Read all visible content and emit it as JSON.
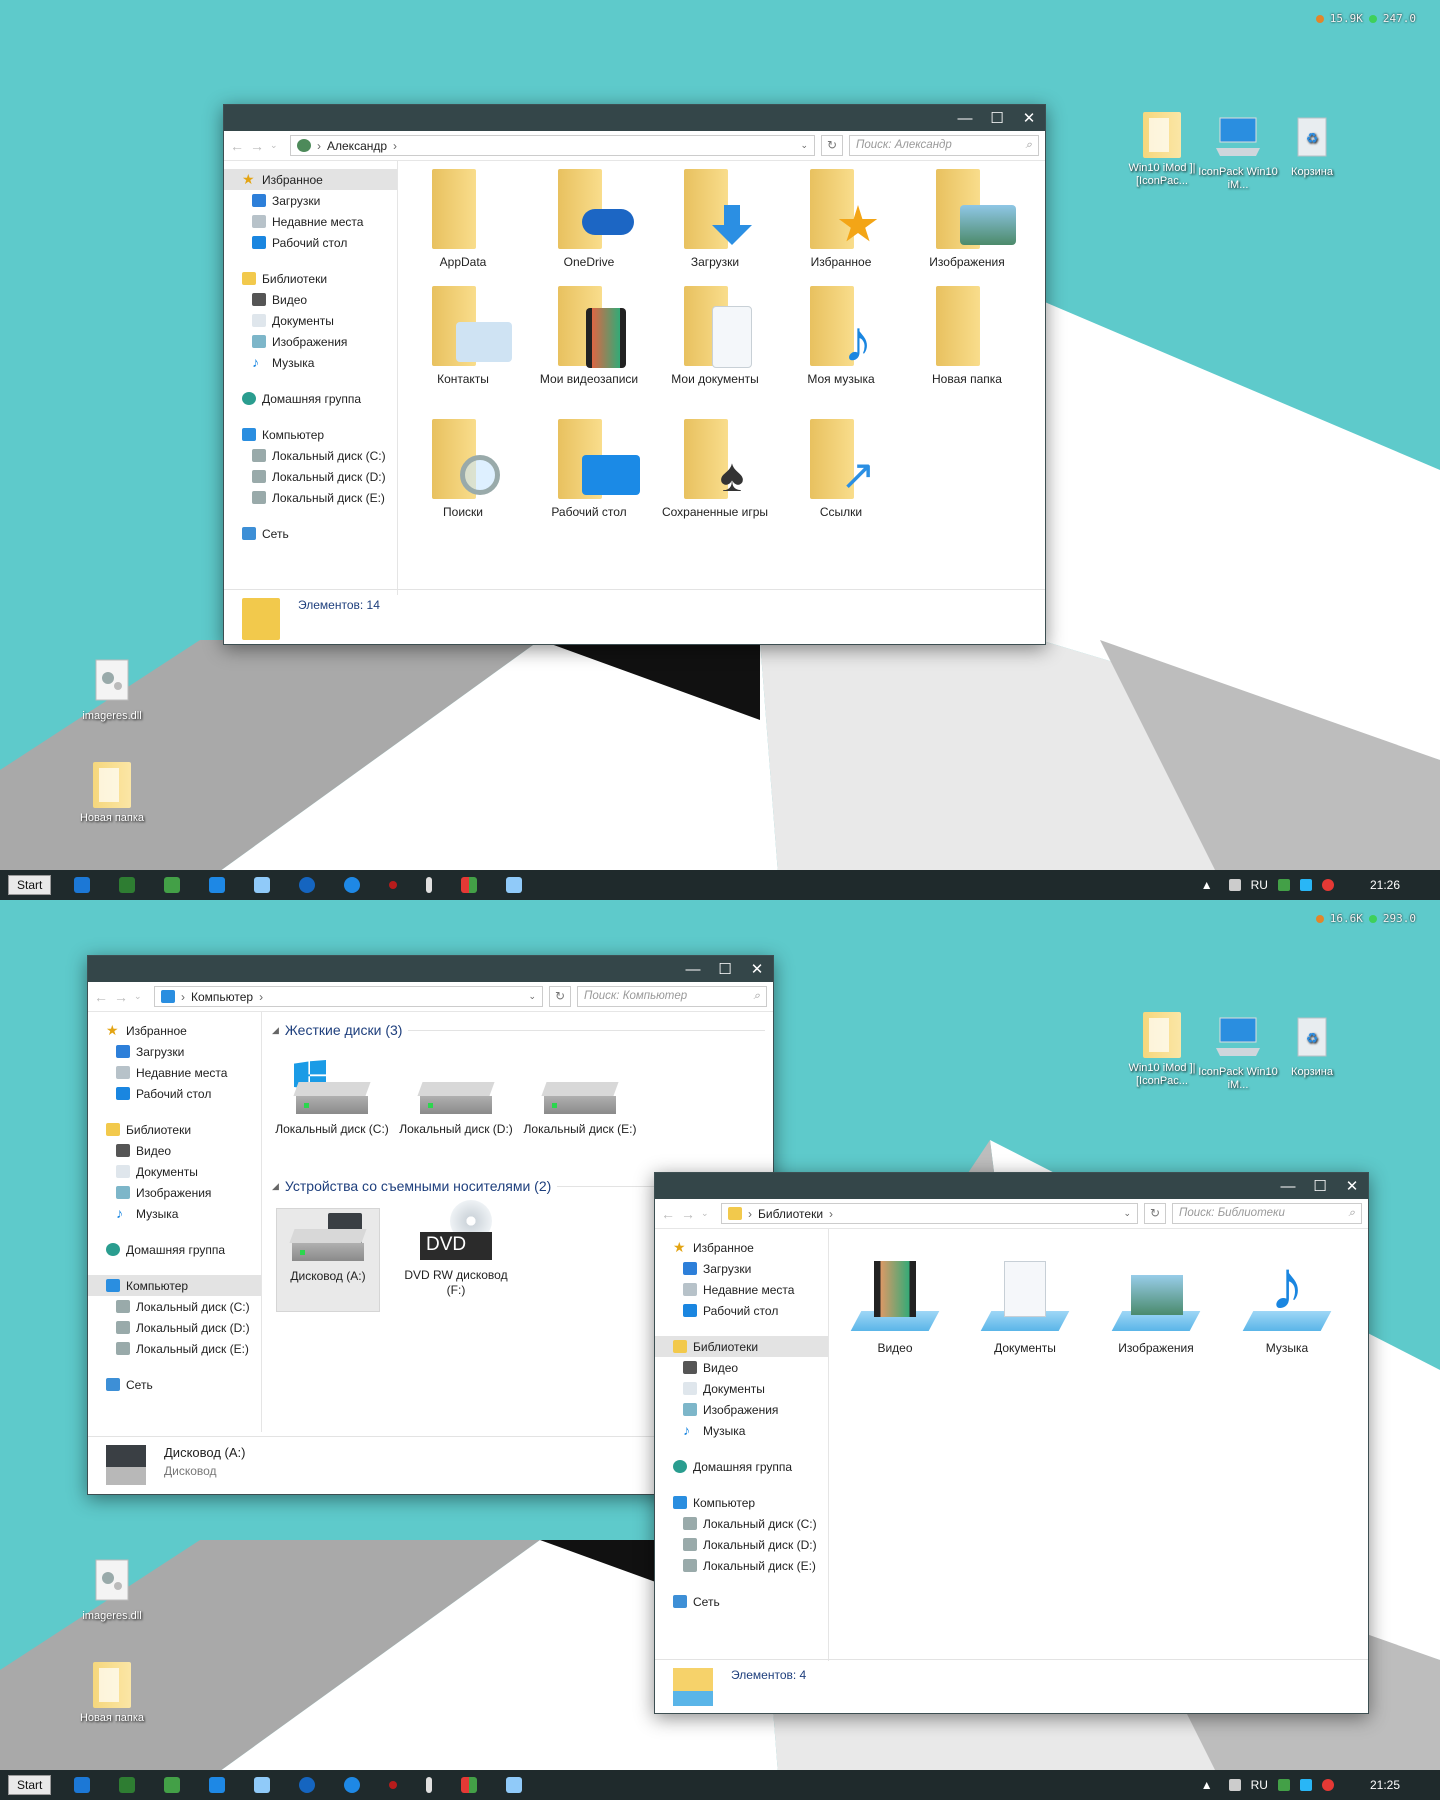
{
  "desktop": {
    "icons": [
      {
        "label": "Win10 iMod ]|[IconPac..."
      },
      {
        "label": "IconPack Win10 iM..."
      },
      {
        "label": "Корзина"
      },
      {
        "label": "imageres.dll"
      },
      {
        "label": "Новая папка"
      }
    ]
  },
  "top": {
    "meter": {
      "left": "15.9K",
      "right": "247.0"
    },
    "clock": "21:26",
    "window": {
      "path": "Александр",
      "search_placeholder": "Поиск: Александр",
      "nav": {
        "favorites": "Избранное",
        "downloads": "Загрузки",
        "recent": "Недавние места",
        "desktop": "Рабочий стол",
        "libraries": "Библиотеки",
        "video": "Видео",
        "docs": "Документы",
        "images": "Изображения",
        "music": "Музыка",
        "homegroup": "Домашняя группа",
        "computer": "Компьютер",
        "disk_c": "Локальный диск (C:)",
        "disk_d": "Локальный диск (D:)",
        "disk_e": "Локальный диск (E:)",
        "network": "Сеть"
      },
      "items": [
        "AppData",
        "OneDrive",
        "Загрузки",
        "Избранное",
        "Изображения",
        "Контакты",
        "Мои видеозаписи",
        "Мои документы",
        "Моя музыка",
        "Новая папка",
        "Поиски",
        "Рабочий стол",
        "Сохраненные игры",
        "Ссылки"
      ],
      "status": "Элементов: 14"
    }
  },
  "bottom": {
    "meter": {
      "left": "16.6K",
      "right": "293.0"
    },
    "clock": "21:25",
    "computer_window": {
      "path": "Компьютер",
      "search_placeholder": "Поиск: Компьютер",
      "group_hdd": "Жесткие диски (3)",
      "group_removable": "Устройства со съемными носителями (2)",
      "drives": [
        "Локальный диск (C:)",
        "Локальный диск (D:)",
        "Локальный диск (E:)"
      ],
      "removable": [
        "Дисковод (A:)",
        "DVD RW дисковод (F:)"
      ],
      "dvd_badge": "DVD",
      "status_title": "Дисковод (A:)",
      "status_sub": "Дисковод"
    },
    "libraries_window": {
      "path": "Библиотеки",
      "search_placeholder": "Поиск: Библиотеки",
      "items": [
        "Видео",
        "Документы",
        "Изображения",
        "Музыка"
      ],
      "status": "Элементов: 4"
    }
  },
  "taskbar": {
    "start": "Start",
    "lang": "RU"
  }
}
